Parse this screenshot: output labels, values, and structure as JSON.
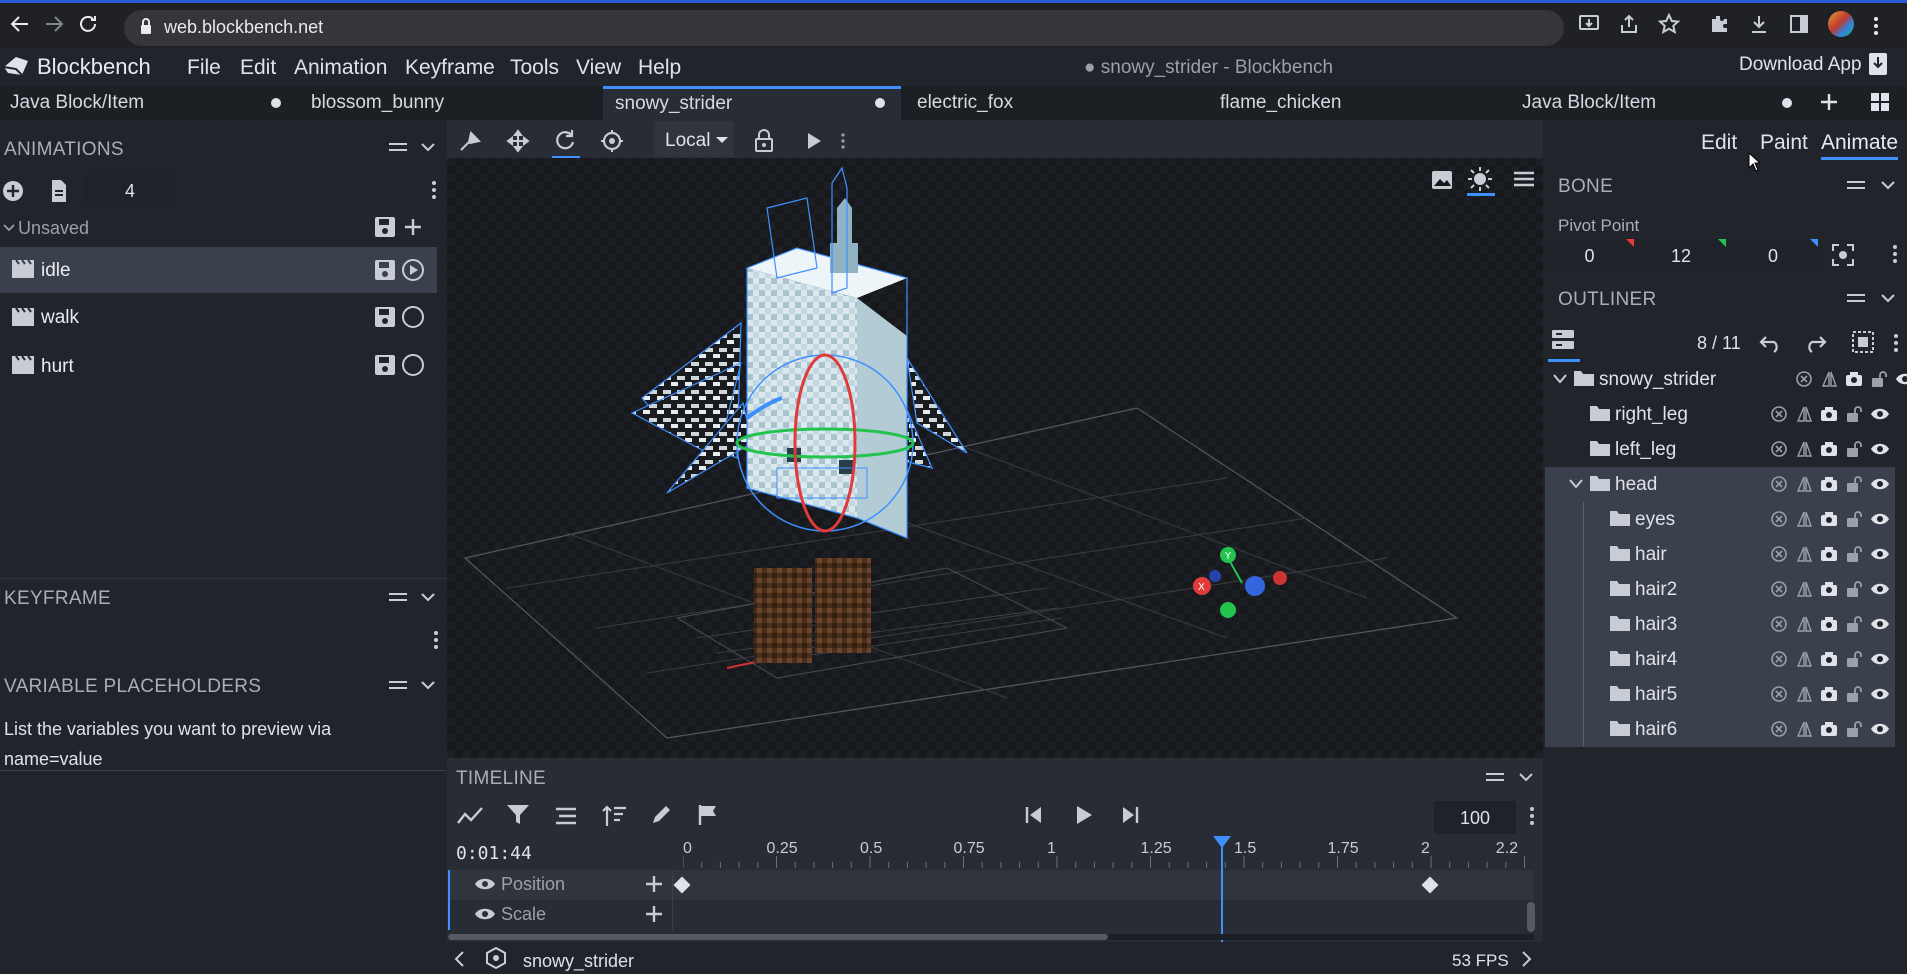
{
  "browser": {
    "url": "web.blockbench.net"
  },
  "app": {
    "logo_text": "Blockbench",
    "window_title": "● snowy_strider - Blockbench",
    "download_label": "Download App",
    "menu": [
      "File",
      "Edit",
      "Animation",
      "Keyframe",
      "Tools",
      "View",
      "Help"
    ]
  },
  "tabs": [
    {
      "label": "Java Block/Item",
      "dot": true
    },
    {
      "label": "blossom_bunny",
      "dot": false
    },
    {
      "label": "snowy_strider",
      "dot": true,
      "active": true
    },
    {
      "label": "electric_fox",
      "dot": false
    },
    {
      "label": "flame_chicken",
      "dot": false
    },
    {
      "label": "Java Block/Item",
      "dot": true
    }
  ],
  "modes": {
    "edit": "Edit",
    "paint": "Paint",
    "animate": "Animate"
  },
  "toolbar": {
    "space": "Local"
  },
  "animations": {
    "title": "ANIMATIONS",
    "count": "4",
    "group": "Unsaved",
    "items": [
      {
        "name": "idle",
        "playing": true
      },
      {
        "name": "walk",
        "playing": false
      },
      {
        "name": "hurt",
        "playing": false
      }
    ]
  },
  "keyframe": {
    "title": "KEYFRAME"
  },
  "variables": {
    "title": "VARIABLE PLACEHOLDERS",
    "hint": "List the variables you want to preview via name=value"
  },
  "bone": {
    "title": "BONE",
    "pivot_label": "Pivot Point",
    "pivot": [
      "0",
      "12",
      "0"
    ]
  },
  "outliner": {
    "title": "OUTLINER",
    "count": "8 / 11",
    "root": "snowy_strider",
    "items": [
      {
        "name": "right_leg",
        "depth": 1
      },
      {
        "name": "left_leg",
        "depth": 1
      },
      {
        "name": "head",
        "depth": 1,
        "expanded": true
      },
      {
        "name": "eyes",
        "depth": 2
      },
      {
        "name": "hair",
        "depth": 2
      },
      {
        "name": "hair2",
        "depth": 2
      },
      {
        "name": "hair3",
        "depth": 2
      },
      {
        "name": "hair4",
        "depth": 2
      },
      {
        "name": "hair5",
        "depth": 2
      },
      {
        "name": "hair6",
        "depth": 2
      }
    ]
  },
  "timeline": {
    "title": "TIMELINE",
    "time": "0:01:44",
    "speed": "100",
    "ticks": [
      "0",
      "0.25",
      "0.5",
      "0.75",
      "1",
      "1.25",
      "1.5",
      "1.75",
      "2",
      "2.2"
    ],
    "playhead": 1.44,
    "channels": [
      "Position",
      "Scale"
    ],
    "keyframes_position": [
      0,
      2
    ]
  },
  "status": {
    "bone": "snowy_strider",
    "fps": "53 FPS"
  },
  "colors": {
    "accent": "#3e90ff",
    "bg": "#21252b",
    "panel": "#282c34"
  }
}
